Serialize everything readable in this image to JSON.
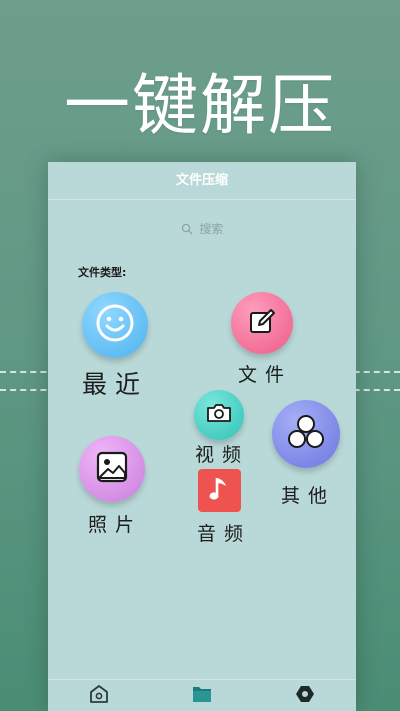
{
  "hero": {
    "title": "一键解压"
  },
  "app": {
    "header_title": "文件压缩",
    "search_placeholder": "搜索",
    "section_label": "文件类型:"
  },
  "categories": [
    {
      "key": "recent",
      "label": "最近",
      "icon": "smiley-icon",
      "color": "#5fc0f3"
    },
    {
      "key": "files",
      "label": "文件",
      "icon": "edit-icon",
      "color": "#f26d94"
    },
    {
      "key": "video",
      "label": "视频",
      "icon": "camera-icon",
      "color": "#3fcfc2"
    },
    {
      "key": "other",
      "label": "其他",
      "icon": "circles-icon",
      "color": "#7b86e8"
    },
    {
      "key": "photos",
      "label": "照片",
      "icon": "image-icon",
      "color": "#d98ce6"
    },
    {
      "key": "audio",
      "label": "音频",
      "icon": "music-note-icon",
      "color": "#ef5350"
    }
  ],
  "nav": [
    {
      "key": "home",
      "icon": "home-icon",
      "active": false
    },
    {
      "key": "files",
      "icon": "folder-icon",
      "active": true
    },
    {
      "key": "settings",
      "icon": "hexagon-icon",
      "active": false
    }
  ]
}
